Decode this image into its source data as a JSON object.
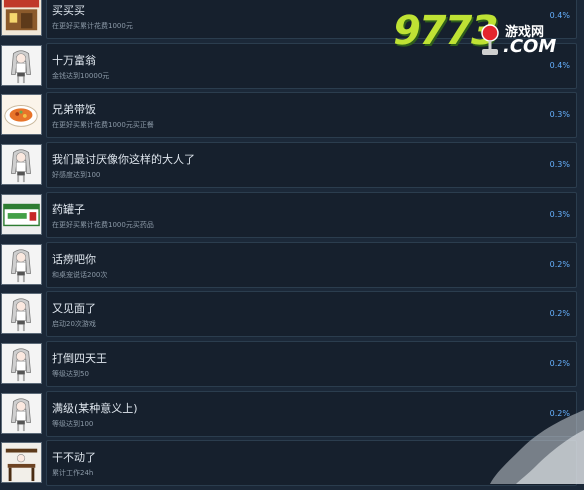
{
  "watermark": {
    "digits": "9773",
    "site": "游戏网",
    "domain": ".COM"
  },
  "achievements": [
    {
      "title": "买买买",
      "desc": "在更好买累计花费1000元",
      "percent": "0.4%",
      "icon": "shop-icon"
    },
    {
      "title": "十万富翁",
      "desc": "金钱达到10000元",
      "percent": "0.4%",
      "icon": "girl-icon"
    },
    {
      "title": "兄弟带饭",
      "desc": "在更好买累计花费1000元买正餐",
      "percent": "0.3%",
      "icon": "food-icon"
    },
    {
      "title": "我们最讨厌像你这样的大人了",
      "desc": "好感度达到100",
      "percent": "0.3%",
      "icon": "girl-icon"
    },
    {
      "title": "药罐子",
      "desc": "在更好买累计花费1000元买药品",
      "percent": "0.3%",
      "icon": "medicine-icon"
    },
    {
      "title": "话痨吧你",
      "desc": "和桌宠说话200次",
      "percent": "0.2%",
      "icon": "girl-icon"
    },
    {
      "title": "又见面了",
      "desc": "启动20次游戏",
      "percent": "0.2%",
      "icon": "girl-icon"
    },
    {
      "title": "打倒四天王",
      "desc": "等级达到50",
      "percent": "0.2%",
      "icon": "girl-icon"
    },
    {
      "title": "满级(某种意义上)",
      "desc": "等级达到100",
      "percent": "0.2%",
      "icon": "girl-icon"
    },
    {
      "title": "干不动了",
      "desc": "累计工作24h",
      "percent": "",
      "icon": "desk-icon"
    }
  ]
}
